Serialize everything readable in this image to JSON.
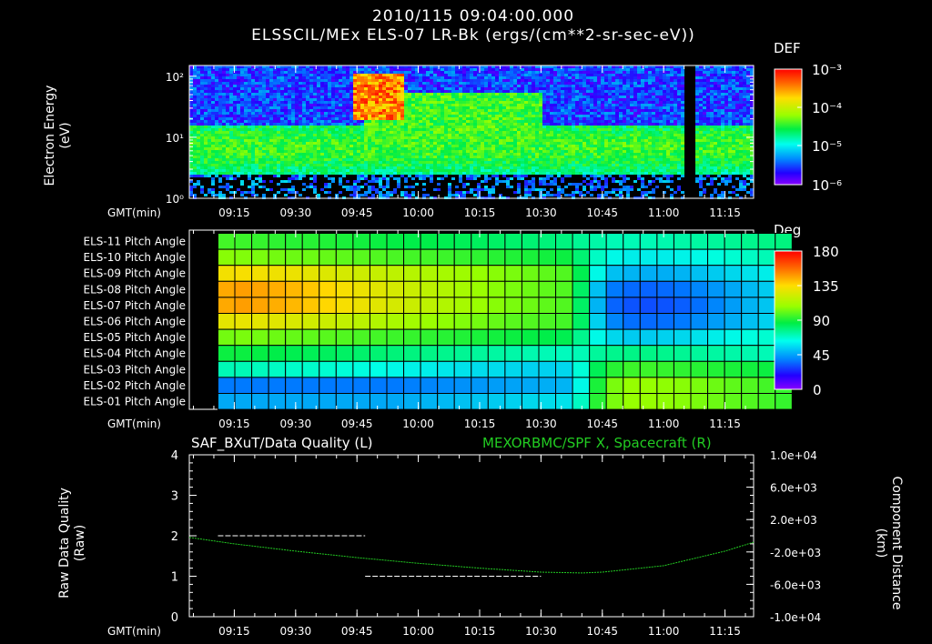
{
  "header": {
    "date_time": "2010/115 09:04:00.000",
    "subtitle": "ELSSCIL/MEx ELS-07 LR-Bk  (ergs/(cm**2-sr-sec-eV))"
  },
  "panel1": {
    "ylabel_line1": "Electron Energy",
    "ylabel_line2": "(eV)",
    "yticks": [
      "10⁰",
      "10¹",
      "10²"
    ],
    "colorbar_title": "DEF",
    "colorbar_ticks": [
      "10⁻³",
      "10⁻⁴",
      "10⁻⁵",
      "10⁻⁶"
    ]
  },
  "panel2": {
    "rows": [
      "ELS-11 Pitch Angle",
      "ELS-10 Pitch Angle",
      "ELS-09 Pitch Angle",
      "ELS-08 Pitch Angle",
      "ELS-07 Pitch Angle",
      "ELS-06 Pitch Angle",
      "ELS-05 Pitch Angle",
      "ELS-04 Pitch Angle",
      "ELS-03 Pitch Angle",
      "ELS-02 Pitch Angle",
      "ELS-01 Pitch Angle"
    ],
    "colorbar_title": "Deg",
    "colorbar_ticks": [
      "180",
      "135",
      "90",
      "45",
      "0"
    ]
  },
  "panel3": {
    "left_title": "SAF_BXuT/Data Quality (L)",
    "right_title": "MEXORBMC/SPF X, Spacecraft (R)",
    "ylabel_left_line1": "Raw Data Quality",
    "ylabel_left_line2": "(Raw)",
    "ylabel_right_line1": "Component Distance",
    "ylabel_right_line2": "(km)",
    "yticks_left": [
      "0",
      "1",
      "2",
      "3",
      "4"
    ],
    "yticks_right": [
      "1.0e+04",
      "6.0e+03",
      "2.0e+03",
      "-2.0e+03",
      "-6.0e+03",
      "-1.0e+04"
    ],
    "colors": {
      "left_series": "#ffffff",
      "right_series": "#22cc22"
    }
  },
  "time_axis": {
    "label": "GMT(min)",
    "ticks": [
      "09:15",
      "09:30",
      "09:45",
      "10:00",
      "10:15",
      "10:30",
      "10:45",
      "11:00",
      "11:15"
    ]
  },
  "chart_data": [
    {
      "type": "heatmap",
      "title": "ELSSCIL/MEx ELS-07 LR-Bk  (ergs/(cm**2-sr-sec-eV))",
      "xlabel": "GMT(min)",
      "ylabel": "Electron Energy (eV)",
      "y_scale": "log",
      "ylim": [
        1,
        150
      ],
      "xlim": [
        "09:04",
        "11:22"
      ],
      "colorbar": {
        "label": "DEF",
        "scale": "log",
        "range": [
          1e-06,
          0.001
        ]
      }
    },
    {
      "type": "heatmap",
      "title": "",
      "xlabel": "GMT(min)",
      "rows": [
        "ELS-11",
        "ELS-10",
        "ELS-09",
        "ELS-08",
        "ELS-07",
        "ELS-06",
        "ELS-05",
        "ELS-04",
        "ELS-03",
        "ELS-02",
        "ELS-01"
      ],
      "xlim": [
        "09:04",
        "11:22"
      ],
      "x_start": "09:11",
      "x_step_min": 4.13,
      "colorbar": {
        "label": "Deg",
        "range": [
          0,
          180
        ]
      },
      "values": [
        [
          96,
          95,
          94,
          93,
          92,
          92,
          91,
          90,
          89,
          88,
          87,
          86,
          86,
          85,
          84,
          83,
          82,
          81,
          80,
          79,
          78,
          75,
          72,
          70,
          70,
          70,
          71,
          72,
          73,
          74,
          75,
          76,
          77,
          78
        ],
        [
          106,
          105,
          104,
          103,
          102,
          102,
          101,
          100,
          99,
          98,
          97,
          96,
          96,
          95,
          94,
          93,
          92,
          91,
          90,
          89,
          88,
          80,
          68,
          62,
          60,
          60,
          60,
          61,
          62,
          64,
          66,
          68,
          70,
          72
        ],
        [
          132,
          133,
          132,
          131,
          130,
          128,
          126,
          124,
          122,
          120,
          118,
          116,
          114,
          112,
          110,
          108,
          106,
          104,
          102,
          100,
          98,
          85,
          62,
          52,
          50,
          49,
          49,
          50,
          52,
          54,
          56,
          58,
          60,
          62
        ],
        [
          145,
          147,
          146,
          144,
          142,
          139,
          136,
          133,
          130,
          127,
          124,
          121,
          118,
          115,
          112,
          109,
          106,
          104,
          102,
          100,
          98,
          82,
          52,
          40,
          37,
          36,
          37,
          39,
          42,
          45,
          48,
          51,
          54,
          57
        ],
        [
          145,
          147,
          146,
          144,
          142,
          139,
          136,
          133,
          130,
          127,
          124,
          121,
          118,
          115,
          112,
          109,
          106,
          104,
          102,
          100,
          98,
          82,
          50,
          36,
          33,
          32,
          33,
          35,
          38,
          42,
          46,
          50,
          53,
          56
        ],
        [
          128,
          129,
          128,
          127,
          125,
          123,
          121,
          119,
          117,
          115,
          113,
          111,
          109,
          107,
          105,
          103,
          101,
          99,
          98,
          97,
          96,
          82,
          55,
          42,
          38,
          37,
          38,
          40,
          43,
          46,
          49,
          52,
          55,
          58
        ],
        [
          103,
          104,
          103,
          102,
          101,
          100,
          99,
          98,
          97,
          96,
          95,
          94,
          93,
          92,
          91,
          90,
          89,
          88,
          87,
          86,
          85,
          76,
          62,
          56,
          54,
          54,
          55,
          56,
          58,
          60,
          62,
          64,
          66,
          68
        ],
        [
          88,
          88,
          87,
          86,
          85,
          84,
          83,
          82,
          81,
          80,
          79,
          78,
          77,
          76,
          75,
          74,
          73,
          72,
          71,
          70,
          69,
          70,
          74,
          76,
          77,
          77,
          76,
          75,
          74,
          73,
          72,
          71,
          70,
          70
        ],
        [
          70,
          70,
          69,
          68,
          67,
          67,
          66,
          65,
          64,
          63,
          62,
          61,
          60,
          59,
          58,
          57,
          57,
          56,
          55,
          55,
          56,
          65,
          84,
          92,
          95,
          95,
          94,
          93,
          92,
          91,
          90,
          89,
          88,
          87
        ],
        [
          40,
          40,
          40,
          40,
          40,
          40,
          40,
          40,
          40,
          40,
          40,
          41,
          42,
          43,
          44,
          45,
          46,
          47,
          48,
          49,
          50,
          62,
          90,
          104,
          108,
          108,
          107,
          106,
          104,
          102,
          100,
          98,
          96,
          94
        ],
        [
          48,
          48,
          48,
          48,
          48,
          48,
          48,
          48,
          48,
          48,
          48,
          49,
          50,
          51,
          52,
          53,
          54,
          55,
          56,
          57,
          58,
          68,
          92,
          104,
          108,
          108,
          107,
          106,
          104,
          102,
          100,
          98,
          96,
          94
        ]
      ]
    },
    {
      "type": "line",
      "title": "SAF_BXuT/Data Quality (L)",
      "xlabel": "GMT(min)",
      "ylabel": "Raw Data Quality (Raw)",
      "ylim": [
        0,
        4
      ],
      "xlim": [
        "09:04",
        "11:22"
      ],
      "series": [
        {
          "name": "SAF_BXuT/Data Quality (L)",
          "axis": "left",
          "segments": [
            {
              "x0": "09:11",
              "x1": "09:47",
              "y": 2
            },
            {
              "x0": "09:47",
              "x1": "10:30",
              "y": 1
            },
            {
              "x0": "10:30",
              "x1": "11:17",
              "y": 0
            }
          ]
        },
        {
          "name": "MEXORBMC/SPF X, Spacecraft (R)",
          "axis": "right",
          "ylim_right": [
            -10000,
            10000
          ],
          "x": [
            "09:04",
            "09:15",
            "09:30",
            "09:45",
            "10:00",
            "10:15",
            "10:30",
            "10:40",
            "10:45",
            "11:00",
            "11:15",
            "11:22"
          ],
          "y": [
            -200,
            -1000,
            -1900,
            -2700,
            -3400,
            -4000,
            -4500,
            -4600,
            -4500,
            -3700,
            -1900,
            -800
          ]
        }
      ]
    }
  ]
}
